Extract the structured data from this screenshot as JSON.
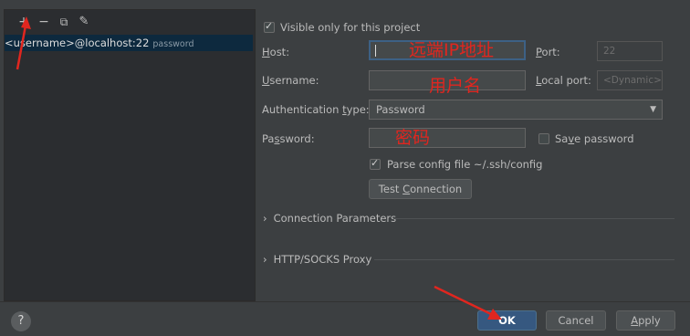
{
  "left": {
    "toolbar": {
      "add": "+",
      "remove": "−",
      "copy": "⧉",
      "edit": "✎"
    },
    "host_entry": {
      "main": "<username>@localhost:22",
      "auth": "password"
    }
  },
  "form": {
    "visible_only": "Visible only for this project",
    "host_label_pre": "H",
    "host_label_post": "ost:",
    "host_note": "远端IP地址",
    "port_label_pre": "P",
    "port_label_post": "ort:",
    "port_value": "22",
    "username_label_pre": "U",
    "username_label_post": "sername:",
    "username_note": "用户名",
    "local_port_label_pre": "L",
    "local_port_label_post": "ocal port:",
    "local_port_value": "<Dynamic>",
    "auth_label_pre": "Authentication ",
    "auth_label_u": "t",
    "auth_label_post": "ype:",
    "auth_value": "Password",
    "password_label_pre": "Pa",
    "password_label_u": "s",
    "password_label_post": "sword:",
    "password_note": "密码",
    "save_password_pre": "Sa",
    "save_password_u": "v",
    "save_password_post": "e password",
    "parse_config": "Parse config file ~/.ssh/config",
    "test_connection_pre": "Test ",
    "test_connection_u": "C",
    "test_connection_post": "onnection",
    "connection_params": "Connection Parameters",
    "proxy": "HTTP/SOCKS Proxy"
  },
  "footer": {
    "help": "?",
    "ok": "OK",
    "cancel": "Cancel",
    "apply_u": "A",
    "apply_post": "pply"
  },
  "colors": {
    "annotation": "#e0261f",
    "arrow": "#e0261f",
    "selection": "#0d293e",
    "primary": "#365880"
  }
}
